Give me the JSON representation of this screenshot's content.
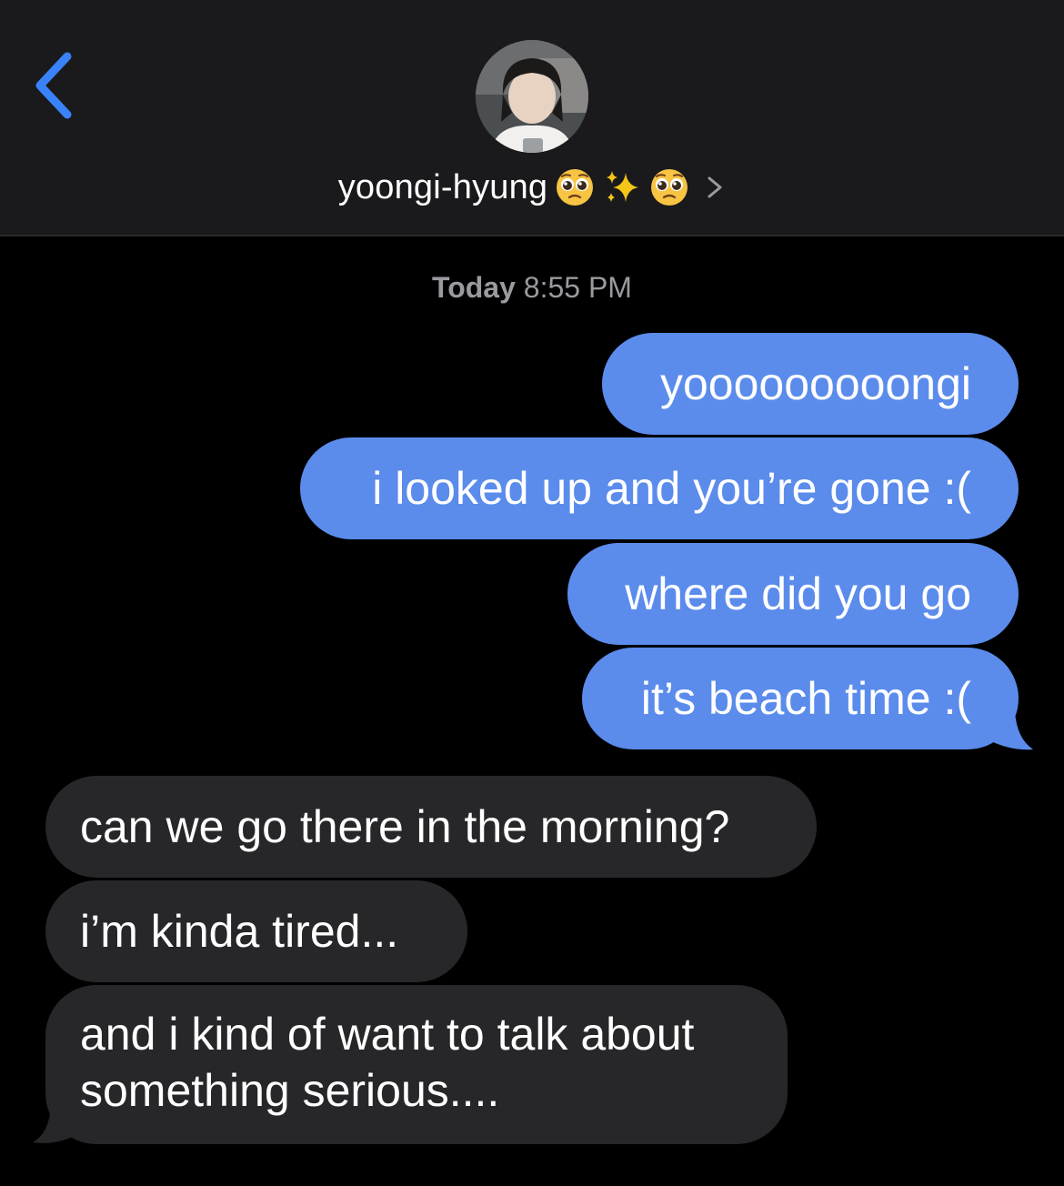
{
  "header": {
    "contact_name": "yoongi-hyung",
    "emojis": [
      "pleading-face",
      "sparkles",
      "pleading-face"
    ],
    "back_icon": "chevron-left-icon",
    "details_icon": "chevron-right-icon"
  },
  "thread": {
    "timestamp_day": "Today",
    "timestamp_time": "8:55 PM"
  },
  "messages": [
    {
      "from": "me",
      "text": "yooooooooongi"
    },
    {
      "from": "me",
      "text": "i looked up and you’re gone :("
    },
    {
      "from": "me",
      "text": "where did you go"
    },
    {
      "from": "me",
      "text": "it’s beach time :("
    },
    {
      "from": "them",
      "text": "can we go there in the morning?"
    },
    {
      "from": "them",
      "text": "i’m kinda tired..."
    },
    {
      "from": "them",
      "line1": "and i kind of want to talk about",
      "line2": "something serious...."
    }
  ],
  "colors": {
    "header_bg": "#1a1a1c",
    "accent_blue": "#3a82f7",
    "sent_bubble": "#5b8cec",
    "received_bubble": "#27272a",
    "timestamp_text": "#9a9aa0"
  }
}
